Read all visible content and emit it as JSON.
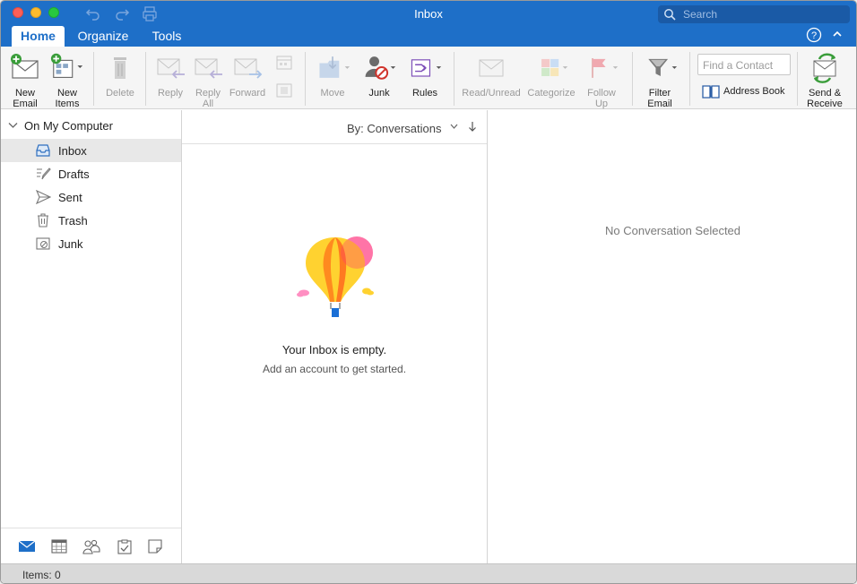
{
  "window": {
    "title": "Inbox"
  },
  "search": {
    "placeholder": "Search"
  },
  "tabs": [
    {
      "label": "Home",
      "active": true
    },
    {
      "label": "Organize",
      "active": false
    },
    {
      "label": "Tools",
      "active": false
    }
  ],
  "ribbon": {
    "new_email": "New Email",
    "new_email_1": "New",
    "new_email_2": "Email",
    "new_items_1": "New",
    "new_items_2": "Items",
    "delete": "Delete",
    "reply": "Reply",
    "reply_all_1": "Reply",
    "reply_all_2": "All",
    "forward": "Forward",
    "move": "Move",
    "junk": "Junk",
    "rules": "Rules",
    "read_unread": "Read/Unread",
    "categorize": "Categorize",
    "follow_up_1": "Follow",
    "follow_up_2": "Up",
    "filter_email_1": "Filter",
    "filter_email_2": "Email",
    "find_contact_placeholder": "Find a Contact",
    "address_book": "Address Book",
    "send_receive_1": "Send &",
    "send_receive_2": "Receive"
  },
  "sidebar": {
    "account": "On My Computer",
    "folders": [
      {
        "label": "Inbox",
        "icon": "inbox-icon",
        "selected": true
      },
      {
        "label": "Drafts",
        "icon": "drafts-icon",
        "selected": false
      },
      {
        "label": "Sent",
        "icon": "sent-icon",
        "selected": false
      },
      {
        "label": "Trash",
        "icon": "trash-icon",
        "selected": false
      },
      {
        "label": "Junk",
        "icon": "junk-icon",
        "selected": false
      }
    ],
    "nav": [
      "mail-icon",
      "calendar-icon",
      "people-icon",
      "tasks-icon",
      "notes-icon"
    ]
  },
  "message_list": {
    "sort_label": "By: Conversations",
    "empty_title": "Your Inbox is empty.",
    "empty_subtitle": "Add an account to get started."
  },
  "reading_pane": {
    "placeholder": "No Conversation Selected"
  },
  "status": {
    "items": "Items: 0"
  },
  "colors": {
    "accent": "#1e6fc8",
    "title_bar": "#1e6fc8",
    "selected_row": "#e8e8e8"
  }
}
